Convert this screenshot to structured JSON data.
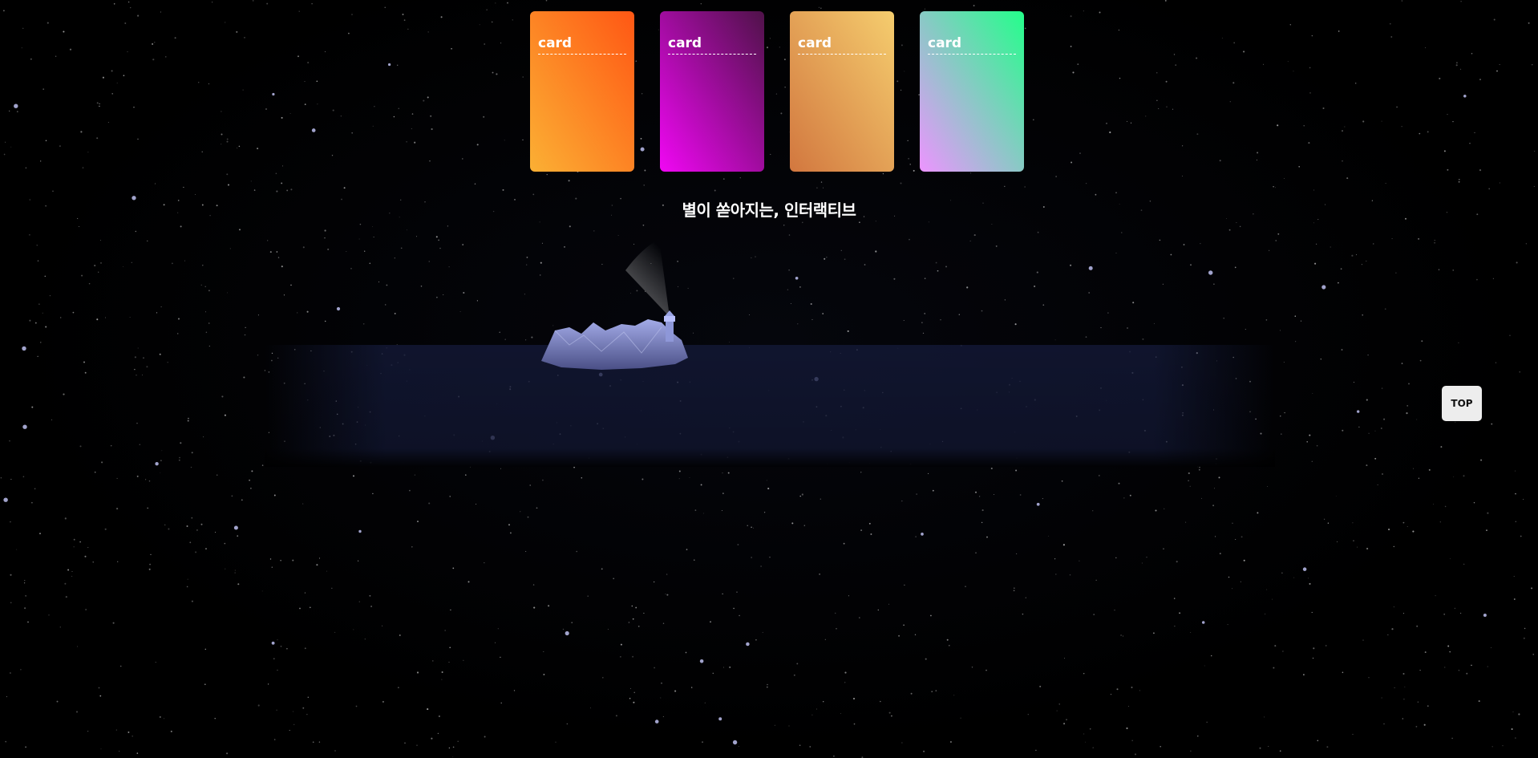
{
  "cards": [
    {
      "label": "card",
      "gradient_from": "#fbb034",
      "gradient_to": "#ff5714"
    },
    {
      "label": "card",
      "gradient_from": "#f107f4",
      "gradient_to": "#4f1249"
    },
    {
      "label": "card",
      "gradient_from": "#d2773f",
      "gradient_to": "#f5cd6e"
    },
    {
      "label": "card",
      "gradient_from": "#ed94ff",
      "gradient_to": "#23ff8a"
    }
  ],
  "headline": "별이 쏟아지는, 인터랙티브",
  "top_button": {
    "label": "TOP"
  },
  "colors": {
    "background": "#000000",
    "sea": "#141a3a",
    "island": "#8a93d6"
  }
}
